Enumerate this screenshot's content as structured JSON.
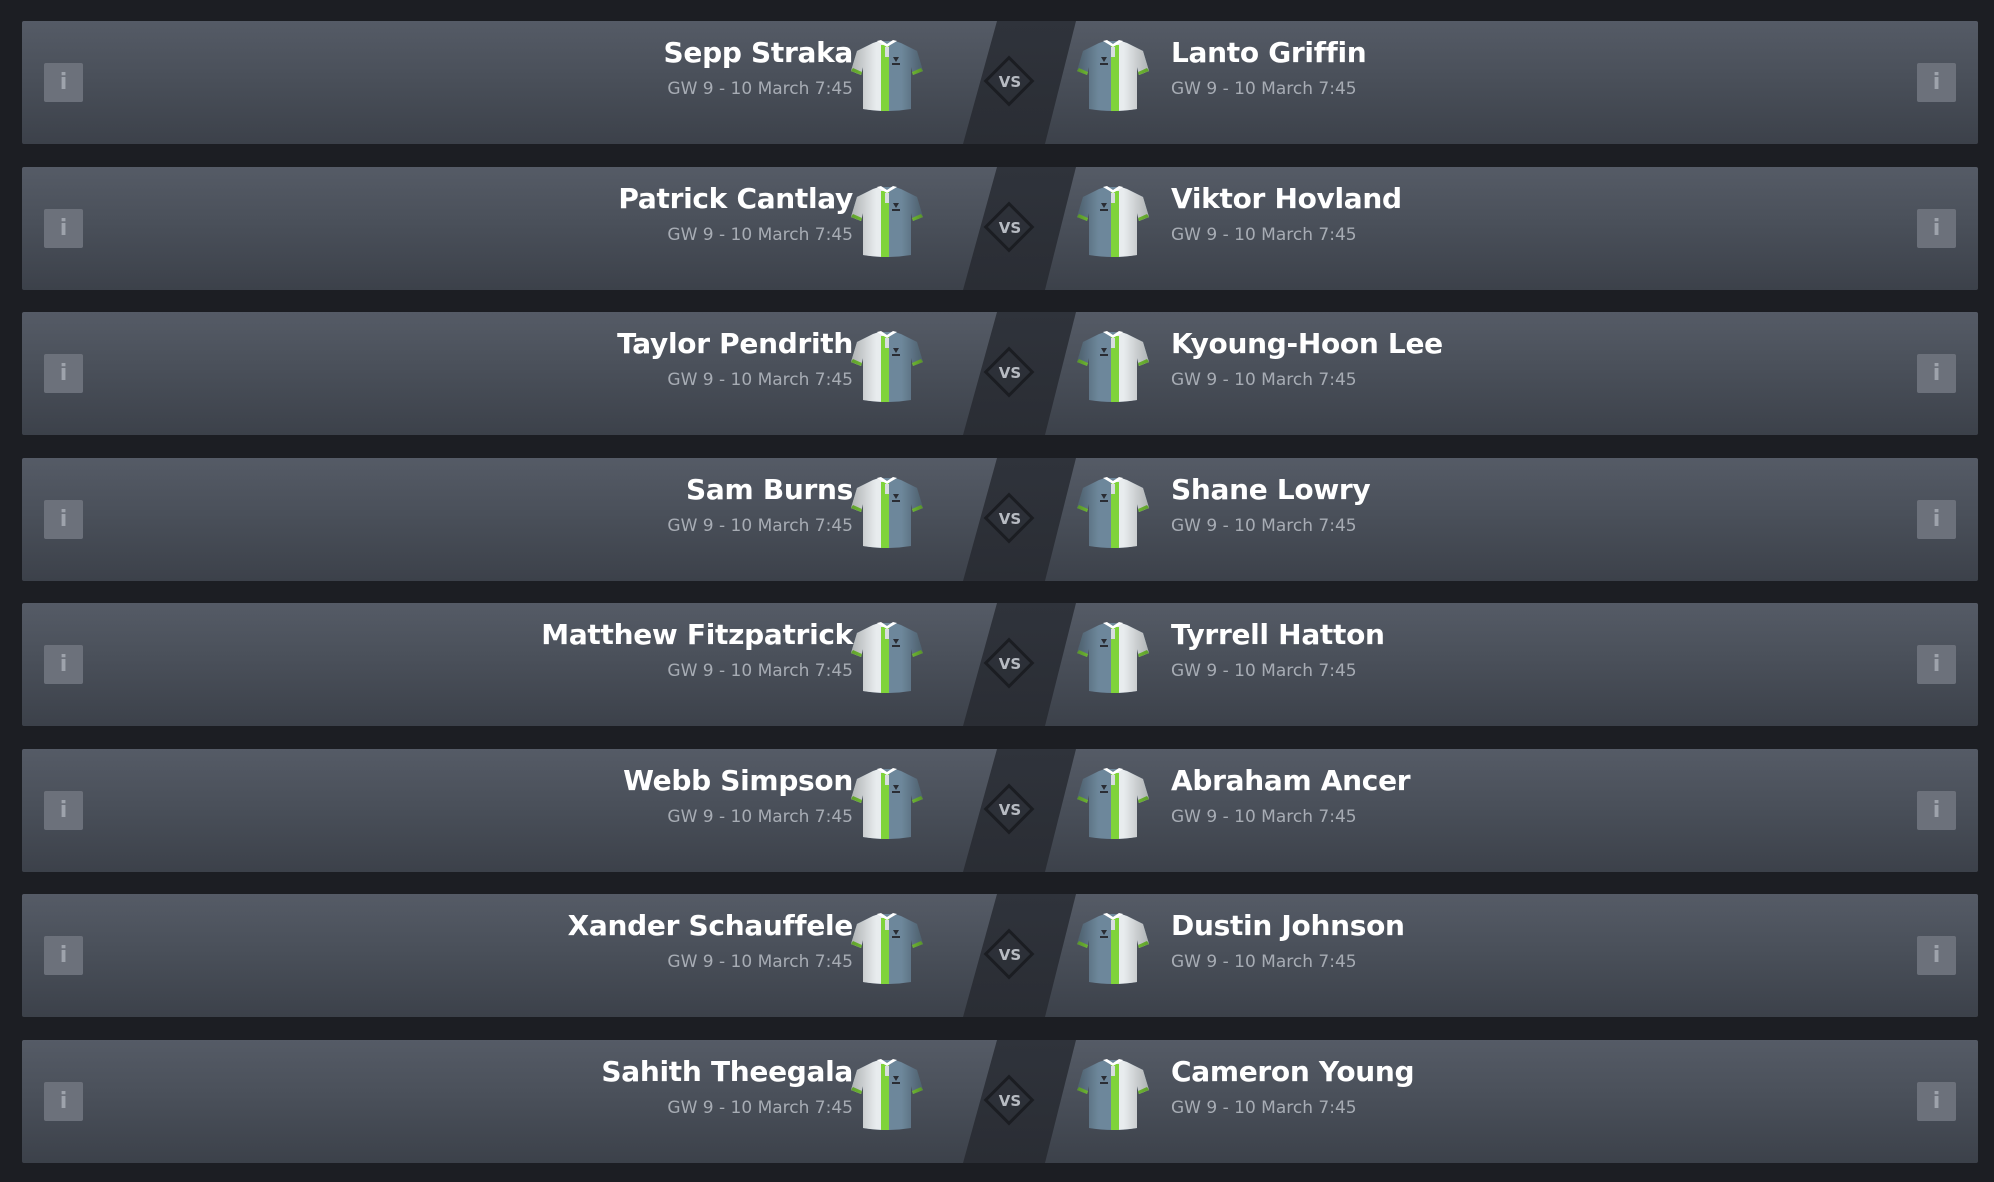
{
  "colors": {
    "background": "#1c1e23",
    "row": "#4b515b",
    "shirt_body": "#6d879b",
    "shirt_stripe": "#7fd33a",
    "shirt_white": "#e8ecee"
  },
  "icons": {
    "info": "info-icon",
    "jersey": "jersey-icon",
    "versus": "vs-diamond-icon"
  },
  "info_label": "i",
  "vs_label": "VS",
  "fixtures": [
    {
      "home": {
        "name": "Sepp Straka",
        "info": "GW 9 - 10 March 7:45"
      },
      "away": {
        "name": "Lanto Griffin",
        "info": "GW 9 - 10 March 7:45"
      }
    },
    {
      "home": {
        "name": "Patrick Cantlay",
        "info": "GW 9 - 10 March 7:45"
      },
      "away": {
        "name": "Viktor Hovland",
        "info": "GW 9 - 10 March 7:45"
      }
    },
    {
      "home": {
        "name": "Taylor Pendrith",
        "info": "GW 9 - 10 March 7:45"
      },
      "away": {
        "name": "Kyoung-Hoon Lee",
        "info": "GW 9 - 10 March 7:45"
      }
    },
    {
      "home": {
        "name": "Sam Burns",
        "info": "GW 9 - 10 March 7:45"
      },
      "away": {
        "name": "Shane Lowry",
        "info": "GW 9 - 10 March 7:45"
      }
    },
    {
      "home": {
        "name": "Matthew Fitzpatrick",
        "info": "GW 9 - 10 March 7:45"
      },
      "away": {
        "name": "Tyrrell Hatton",
        "info": "GW 9 - 10 March 7:45"
      }
    },
    {
      "home": {
        "name": "Webb Simpson",
        "info": "GW 9 - 10 March 7:45"
      },
      "away": {
        "name": "Abraham Ancer",
        "info": "GW 9 - 10 March 7:45"
      }
    },
    {
      "home": {
        "name": "Xander Schauffele",
        "info": "GW 9 - 10 March 7:45"
      },
      "away": {
        "name": "Dustin Johnson",
        "info": "GW 9 - 10 March 7:45"
      }
    },
    {
      "home": {
        "name": "Sahith Theegala",
        "info": "GW 9 - 10 March 7:45"
      },
      "away": {
        "name": "Cameron Young",
        "info": "GW 9 - 10 March 7:45"
      }
    }
  ]
}
